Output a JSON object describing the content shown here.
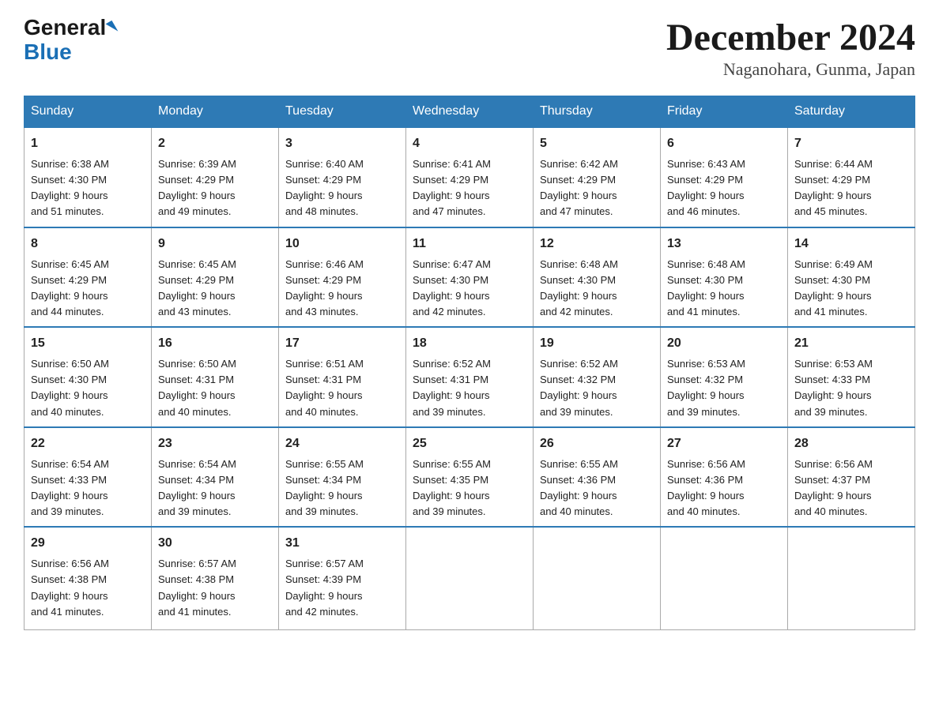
{
  "logo": {
    "general": "General",
    "arrow": "▶",
    "blue": "Blue"
  },
  "title": "December 2024",
  "location": "Naganohara, Gunma, Japan",
  "days_of_week": [
    "Sunday",
    "Monday",
    "Tuesday",
    "Wednesday",
    "Thursday",
    "Friday",
    "Saturday"
  ],
  "weeks": [
    [
      {
        "day": "1",
        "sunrise": "6:38 AM",
        "sunset": "4:30 PM",
        "daylight": "9 hours and 51 minutes."
      },
      {
        "day": "2",
        "sunrise": "6:39 AM",
        "sunset": "4:29 PM",
        "daylight": "9 hours and 49 minutes."
      },
      {
        "day": "3",
        "sunrise": "6:40 AM",
        "sunset": "4:29 PM",
        "daylight": "9 hours and 48 minutes."
      },
      {
        "day": "4",
        "sunrise": "6:41 AM",
        "sunset": "4:29 PM",
        "daylight": "9 hours and 47 minutes."
      },
      {
        "day": "5",
        "sunrise": "6:42 AM",
        "sunset": "4:29 PM",
        "daylight": "9 hours and 47 minutes."
      },
      {
        "day": "6",
        "sunrise": "6:43 AM",
        "sunset": "4:29 PM",
        "daylight": "9 hours and 46 minutes."
      },
      {
        "day": "7",
        "sunrise": "6:44 AM",
        "sunset": "4:29 PM",
        "daylight": "9 hours and 45 minutes."
      }
    ],
    [
      {
        "day": "8",
        "sunrise": "6:45 AM",
        "sunset": "4:29 PM",
        "daylight": "9 hours and 44 minutes."
      },
      {
        "day": "9",
        "sunrise": "6:45 AM",
        "sunset": "4:29 PM",
        "daylight": "9 hours and 43 minutes."
      },
      {
        "day": "10",
        "sunrise": "6:46 AM",
        "sunset": "4:29 PM",
        "daylight": "9 hours and 43 minutes."
      },
      {
        "day": "11",
        "sunrise": "6:47 AM",
        "sunset": "4:30 PM",
        "daylight": "9 hours and 42 minutes."
      },
      {
        "day": "12",
        "sunrise": "6:48 AM",
        "sunset": "4:30 PM",
        "daylight": "9 hours and 42 minutes."
      },
      {
        "day": "13",
        "sunrise": "6:48 AM",
        "sunset": "4:30 PM",
        "daylight": "9 hours and 41 minutes."
      },
      {
        "day": "14",
        "sunrise": "6:49 AM",
        "sunset": "4:30 PM",
        "daylight": "9 hours and 41 minutes."
      }
    ],
    [
      {
        "day": "15",
        "sunrise": "6:50 AM",
        "sunset": "4:30 PM",
        "daylight": "9 hours and 40 minutes."
      },
      {
        "day": "16",
        "sunrise": "6:50 AM",
        "sunset": "4:31 PM",
        "daylight": "9 hours and 40 minutes."
      },
      {
        "day": "17",
        "sunrise": "6:51 AM",
        "sunset": "4:31 PM",
        "daylight": "9 hours and 40 minutes."
      },
      {
        "day": "18",
        "sunrise": "6:52 AM",
        "sunset": "4:31 PM",
        "daylight": "9 hours and 39 minutes."
      },
      {
        "day": "19",
        "sunrise": "6:52 AM",
        "sunset": "4:32 PM",
        "daylight": "9 hours and 39 minutes."
      },
      {
        "day": "20",
        "sunrise": "6:53 AM",
        "sunset": "4:32 PM",
        "daylight": "9 hours and 39 minutes."
      },
      {
        "day": "21",
        "sunrise": "6:53 AM",
        "sunset": "4:33 PM",
        "daylight": "9 hours and 39 minutes."
      }
    ],
    [
      {
        "day": "22",
        "sunrise": "6:54 AM",
        "sunset": "4:33 PM",
        "daylight": "9 hours and 39 minutes."
      },
      {
        "day": "23",
        "sunrise": "6:54 AM",
        "sunset": "4:34 PM",
        "daylight": "9 hours and 39 minutes."
      },
      {
        "day": "24",
        "sunrise": "6:55 AM",
        "sunset": "4:34 PM",
        "daylight": "9 hours and 39 minutes."
      },
      {
        "day": "25",
        "sunrise": "6:55 AM",
        "sunset": "4:35 PM",
        "daylight": "9 hours and 39 minutes."
      },
      {
        "day": "26",
        "sunrise": "6:55 AM",
        "sunset": "4:36 PM",
        "daylight": "9 hours and 40 minutes."
      },
      {
        "day": "27",
        "sunrise": "6:56 AM",
        "sunset": "4:36 PM",
        "daylight": "9 hours and 40 minutes."
      },
      {
        "day": "28",
        "sunrise": "6:56 AM",
        "sunset": "4:37 PM",
        "daylight": "9 hours and 40 minutes."
      }
    ],
    [
      {
        "day": "29",
        "sunrise": "6:56 AM",
        "sunset": "4:38 PM",
        "daylight": "9 hours and 41 minutes."
      },
      {
        "day": "30",
        "sunrise": "6:57 AM",
        "sunset": "4:38 PM",
        "daylight": "9 hours and 41 minutes."
      },
      {
        "day": "31",
        "sunrise": "6:57 AM",
        "sunset": "4:39 PM",
        "daylight": "9 hours and 42 minutes."
      },
      null,
      null,
      null,
      null
    ]
  ],
  "labels": {
    "sunrise": "Sunrise:",
    "sunset": "Sunset:",
    "daylight": "Daylight:"
  }
}
